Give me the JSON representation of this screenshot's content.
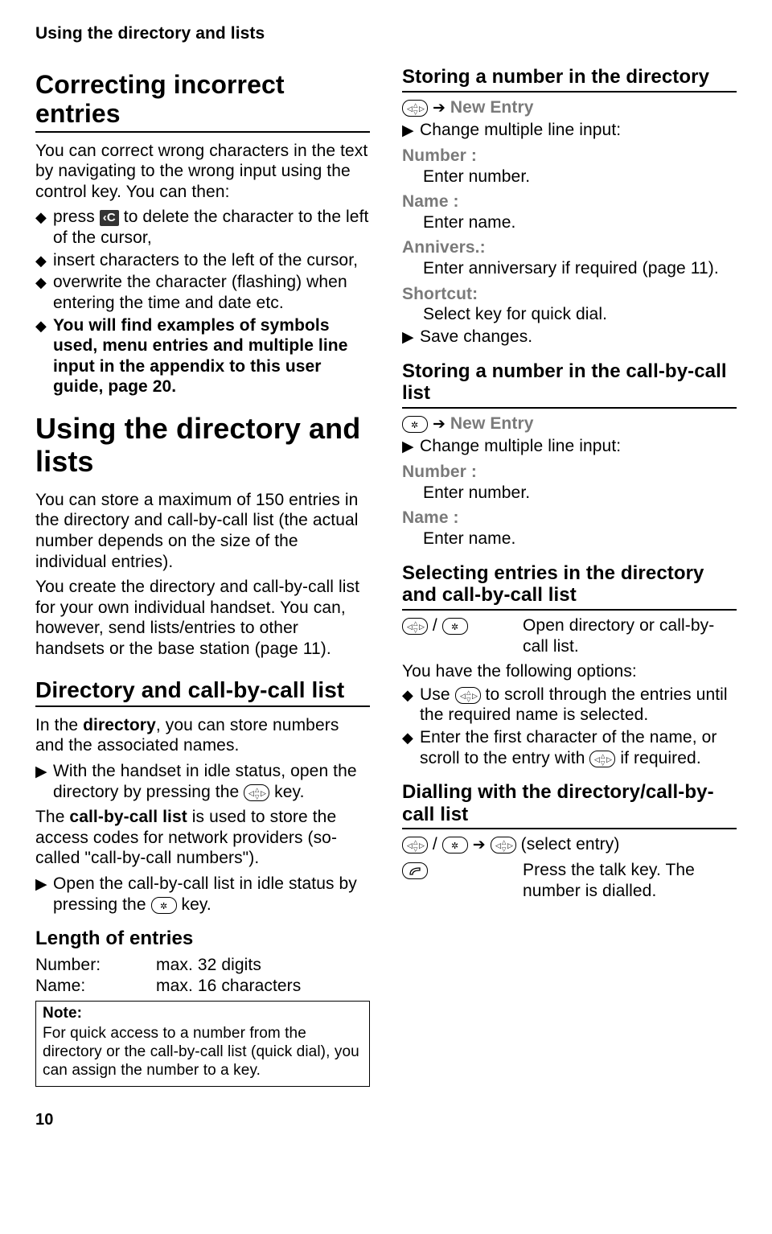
{
  "running_head": "Using the directory and lists",
  "page_number": "10",
  "icons": {
    "diamond": "◆",
    "tri": "▶",
    "arrow": "➔"
  },
  "col1": {
    "h_correcting": "Correcting incorrect entries",
    "p_intro": "You can correct wrong characters in the text by navigating to the wrong input using the control key. You can then:",
    "bl1_pre": "press ",
    "bl1_post": " to delete the character to the left of the cursor,",
    "bl1_key": "‹C",
    "bl2": "insert characters to the left of the cursor,",
    "bl3": "overwrite the character (flashing) when entering the time and date etc.",
    "bl4": "You will find examples of symbols used, menu entries and multiple line input in the appendix to this user guide, page 20.",
    "h_using": "Using the directory and lists",
    "p_store": "You can store a maximum of 150 entries in the directory and call-by-call list (the actual number depends on the size of the individual entries).",
    "p_create": "You create the directory and call-by-call list for your own individual handset. You can, however, send lists/entries to other handsets or the base station (page 11).",
    "h_dir": "Directory and call-by-call list",
    "p_dir_pre": "In the ",
    "p_dir_b": "directory",
    "p_dir_post": ", you can store numbers and the associated names.",
    "t_dir_pre": "With the handset in idle status, open the directory by pressing the ",
    "t_dir_post": " key.",
    "p_cbc_pre": "The ",
    "p_cbc_b": "call-by-call list",
    "p_cbc_post": " is used to store the access codes for network providers (so-called \"call-by-call numbers\").",
    "t_cbc_pre": "Open the call-by-call list in idle status by pressing the ",
    "t_cbc_post": " key.",
    "h_len": "Length of entries",
    "len_num_l": "Number:",
    "len_num_v": "max. 32 digits",
    "len_name_l": "Name:",
    "len_name_v": "max. 16 characters",
    "note_h": "Note:",
    "note_b": "For quick access to a number from the directory or the call-by-call list (quick dial), you can assign the number to a key."
  },
  "col2": {
    "h_store_dir": "Storing a number in the directory",
    "new_entry": "New Entry",
    "change_multi": "Change multiple line input:",
    "f_number": "Number :",
    "f_number_v": "Enter number.",
    "f_name": "Name :",
    "f_name_v": "Enter name.",
    "f_anniv": "Annivers.:",
    "f_anniv_v": "Enter anniversary if required (page 11).",
    "f_short": "Shortcut:",
    "f_short_v": "Select key for quick dial.",
    "save": "Save changes.",
    "h_store_cbc": "Storing a number in the call-by-call list",
    "h_select": "Selecting entries in the directory and call-by-call list",
    "sel_open": "Open directory or call-by-call list.",
    "sel_options": "You have the following options:",
    "sel_b1a": "Use ",
    "sel_b1b": " to scroll through the entries until the required name is selected.",
    "sel_b2a": "Enter the first character of the name, or scroll to the entry with ",
    "sel_b2b": " if required.",
    "h_dial": "Dialling with the directory/call-by-call list",
    "dial_tail": "(select entry)",
    "dial_talk": "Press the talk key. The number is dialled."
  }
}
